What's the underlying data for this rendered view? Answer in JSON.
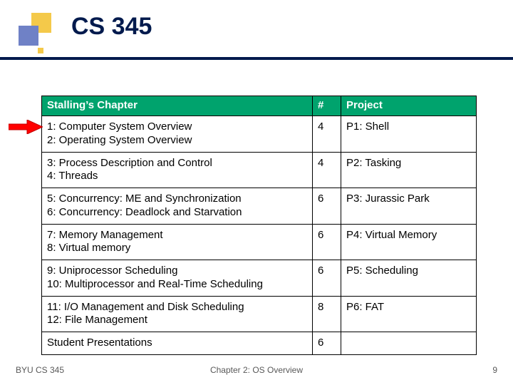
{
  "title": "CS 345",
  "table": {
    "headers": {
      "chapter": "Stalling’s Chapter",
      "num": "#",
      "project": "Project"
    },
    "rows": [
      {
        "chapter": "1: Computer System Overview\n2: Operating System Overview",
        "num": "4",
        "project": "P1: Shell"
      },
      {
        "chapter": "3: Process Description and Control\n4: Threads",
        "num": "4",
        "project": "P2: Tasking"
      },
      {
        "chapter": "5: Concurrency: ME and Synchronization\n6: Concurrency: Deadlock and Starvation",
        "num": "6",
        "project": "P3: Jurassic Park"
      },
      {
        "chapter": "7: Memory Management\n8: Virtual memory",
        "num": "6",
        "project": "P4: Virtual Memory"
      },
      {
        "chapter": "9: Uniprocessor Scheduling\n10: Multiprocessor and Real-Time Scheduling",
        "num": "6",
        "project": "P5: Scheduling"
      },
      {
        "chapter": "11: I/O Management and Disk Scheduling\n12: File Management",
        "num": "8",
        "project": "P6: FAT"
      },
      {
        "chapter": "Student Presentations",
        "num": "6",
        "project": ""
      }
    ]
  },
  "footer": {
    "left": "BYU CS 345",
    "center": "Chapter 2: OS Overview",
    "right": "9"
  }
}
